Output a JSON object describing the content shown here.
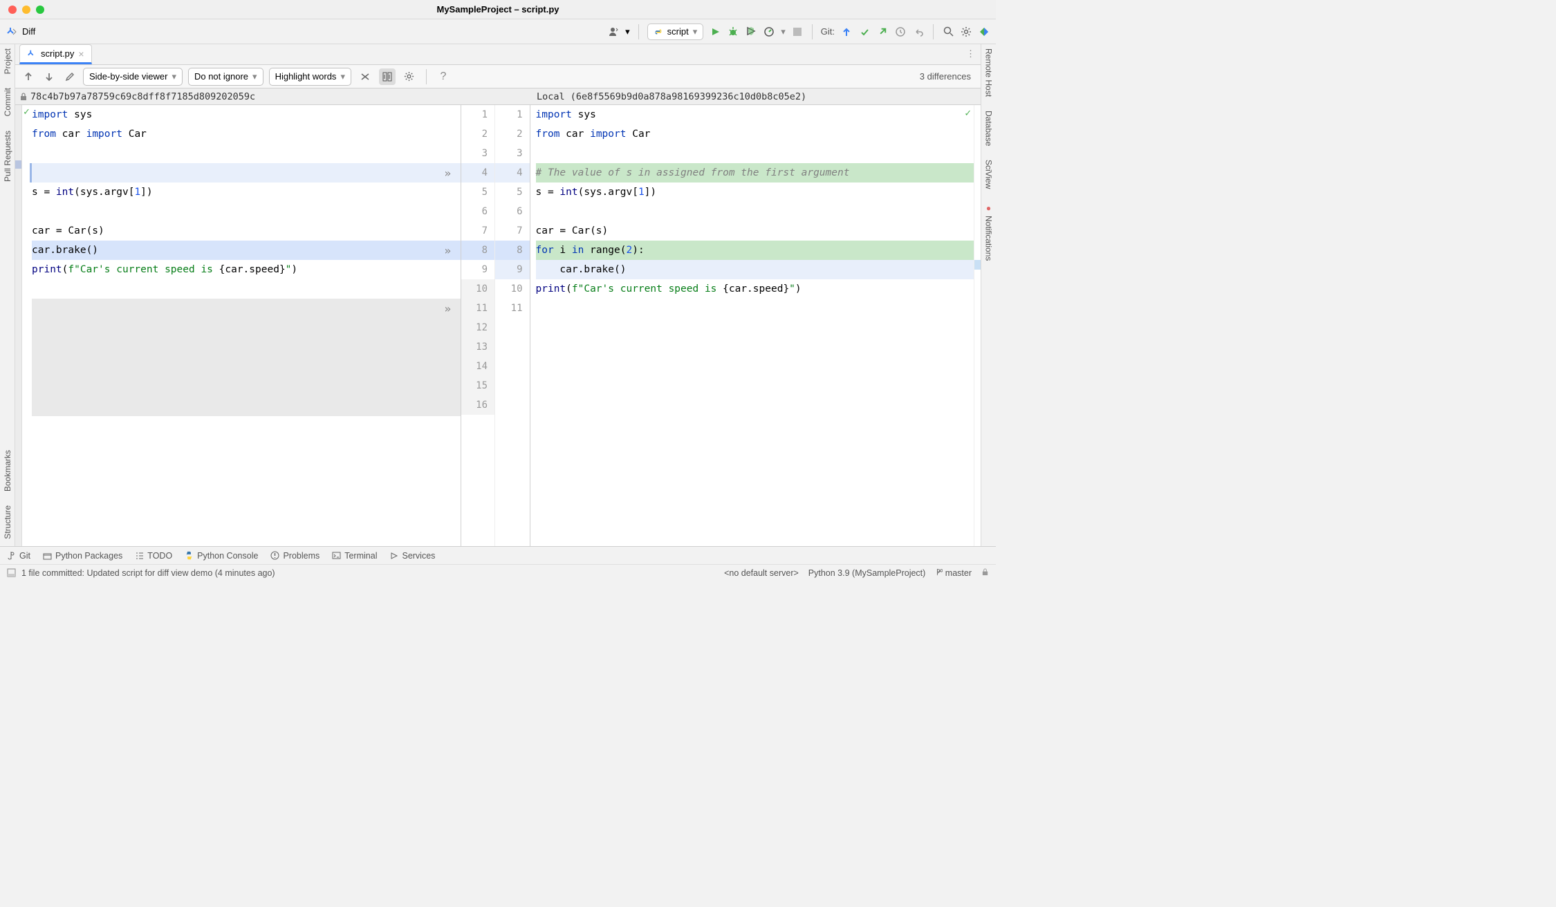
{
  "window_title": "MySampleProject – script.py",
  "breadcrumb": "Diff",
  "run_config": "script",
  "git_label": "Git:",
  "file_tab": "script.py",
  "left_sidebar": [
    "Project",
    "Commit",
    "Pull Requests",
    "Bookmarks",
    "Structure"
  ],
  "right_sidebar": [
    "Remote Host",
    "Database",
    "SciView",
    "Notifications"
  ],
  "diff_toolbar": {
    "viewer_mode": "Side-by-side viewer",
    "ignore_mode": "Do not ignore",
    "highlight_mode": "Highlight words",
    "diff_count": "3 differences"
  },
  "revisions": {
    "left_hash": "78c4b7b97a78759c69c8dff8f7185d809202059c",
    "right_label": "Local (6e8f5569b9d0a878a98169399236c10d0b8c05e2)"
  },
  "left_code": {
    "l1": "import sys",
    "l2_from": "from",
    "l2_car": "car",
    "l2_import": "import",
    "l2_Car": "Car",
    "l3": "",
    "l4": "",
    "l5_a": "s = ",
    "l5_b": "int",
    "l5_c": "(sys.argv[",
    "l5_d": "1",
    "l5_e": "])",
    "l6": "",
    "l7": "car = Car(s)",
    "l8": "car.brake()",
    "l9_a": "print",
    "l9_b": "(",
    "l9_c": "f\"Car's current speed is ",
    "l9_d": "{car.speed}",
    "l9_e": "\"",
    "l9_f": ")"
  },
  "right_code": {
    "l1": "import sys",
    "l2_from": "from",
    "l2_car": "car",
    "l2_import": "import",
    "l2_Car": "Car",
    "l3": "",
    "l4": "# The value of s in assigned from the first argument",
    "l5_a": "s = ",
    "l5_b": "int",
    "l5_c": "(sys.argv[",
    "l5_d": "1",
    "l5_e": "])",
    "l6": "",
    "l7": "car = Car(s)",
    "l8_for": "for",
    "l8_i": " i ",
    "l8_in": "in",
    "l8_range": " range(",
    "l8_2": "2",
    "l8_end": "):",
    "l9": "    car.brake()",
    "l10_a": "print",
    "l10_b": "(",
    "l10_c": "f\"Car's current speed is ",
    "l10_d": "{car.speed}",
    "l10_e": "\"",
    "l10_f": ")"
  },
  "gutter_left": [
    "1",
    "2",
    "3",
    "4",
    "5",
    "6",
    "7",
    "8",
    "9",
    "10",
    "11",
    "12",
    "13",
    "14",
    "15",
    "16"
  ],
  "gutter_right": [
    "1",
    "2",
    "3",
    "4",
    "5",
    "6",
    "7",
    "8",
    "9",
    "10",
    "11"
  ],
  "bottom_tools": [
    "Git",
    "Python Packages",
    "TODO",
    "Python Console",
    "Problems",
    "Terminal",
    "Services"
  ],
  "status": {
    "commit_msg": "1 file committed: Updated script for diff view demo (4 minutes ago)",
    "server": "<no default server>",
    "interpreter": "Python 3.9 (MySampleProject)",
    "branch": "master"
  }
}
